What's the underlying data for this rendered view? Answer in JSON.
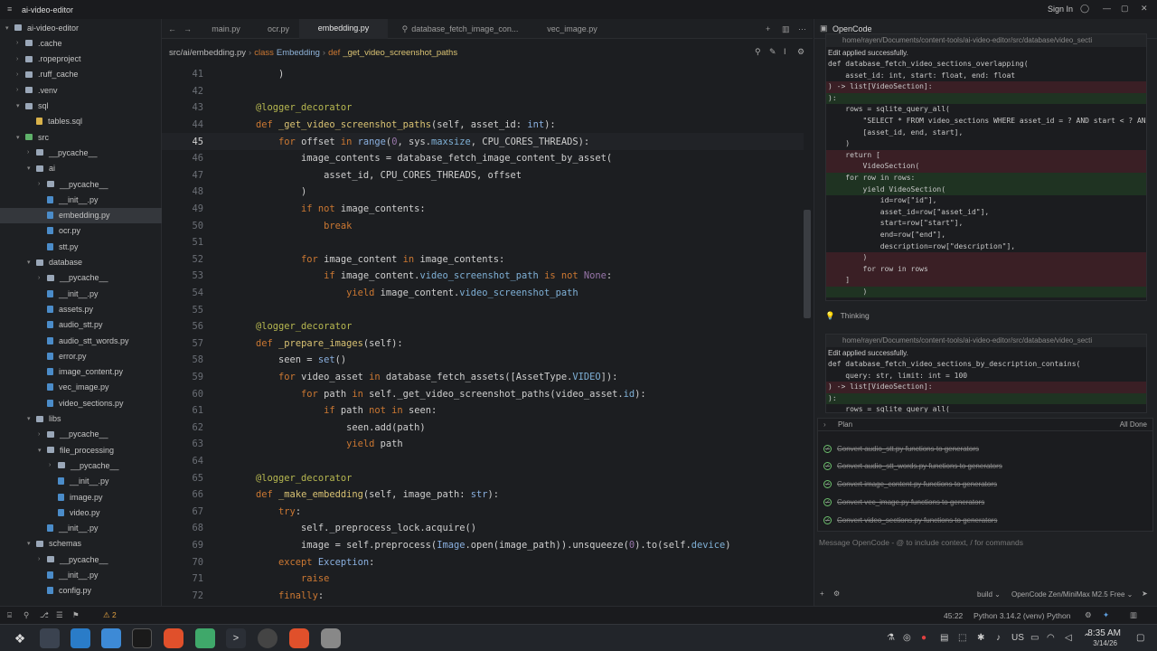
{
  "window": {
    "title": "ai-video-editor",
    "sign_in": "Sign In"
  },
  "sidebar": {
    "items": [
      {
        "label": "ai-video-editor",
        "icon": "folder-icon",
        "depth": 0,
        "open": true
      },
      {
        "label": ".cache",
        "icon": "folder-icon",
        "depth": 1
      },
      {
        "label": ".ropeproject",
        "icon": "folder-icon",
        "depth": 1
      },
      {
        "label": ".ruff_cache",
        "icon": "folder-icon",
        "depth": 1
      },
      {
        "label": ".venv",
        "icon": "folder-icon",
        "depth": 1
      },
      {
        "label": "sql",
        "icon": "folder-icon",
        "depth": 1,
        "open": true
      },
      {
        "label": "tables.sql",
        "icon": "sql-file-icon",
        "depth": 2
      },
      {
        "label": "src",
        "icon": "folder-icon",
        "depth": 1,
        "open": true
      },
      {
        "label": "__pycache__",
        "icon": "folder-icon",
        "depth": 2
      },
      {
        "label": "ai",
        "icon": "folder-icon",
        "depth": 2,
        "open": true
      },
      {
        "label": "__pycache__",
        "icon": "folder-icon",
        "depth": 3
      },
      {
        "label": "__init__.py",
        "icon": "python-file-icon",
        "depth": 3
      },
      {
        "label": "embedding.py",
        "icon": "python-file-icon",
        "depth": 3,
        "selected": true
      },
      {
        "label": "ocr.py",
        "icon": "python-file-icon",
        "depth": 3
      },
      {
        "label": "stt.py",
        "icon": "python-file-icon",
        "depth": 3
      },
      {
        "label": "database",
        "icon": "folder-icon",
        "depth": 2,
        "open": true
      },
      {
        "label": "__pycache__",
        "icon": "folder-icon",
        "depth": 3
      },
      {
        "label": "__init__.py",
        "icon": "python-file-icon",
        "depth": 3
      },
      {
        "label": "assets.py",
        "icon": "python-file-icon",
        "depth": 3
      },
      {
        "label": "audio_stt.py",
        "icon": "python-file-icon",
        "depth": 3
      },
      {
        "label": "audio_stt_words.py",
        "icon": "python-file-icon",
        "depth": 3
      },
      {
        "label": "error.py",
        "icon": "python-file-icon",
        "depth": 3
      },
      {
        "label": "image_content.py",
        "icon": "python-file-icon",
        "depth": 3
      },
      {
        "label": "vec_image.py",
        "icon": "python-file-icon",
        "depth": 3
      },
      {
        "label": "video_sections.py",
        "icon": "python-file-icon",
        "depth": 3
      },
      {
        "label": "libs",
        "icon": "folder-icon",
        "depth": 2,
        "open": true
      },
      {
        "label": "__pycache__",
        "icon": "folder-icon",
        "depth": 3
      },
      {
        "label": "file_processing",
        "icon": "folder-icon",
        "depth": 3,
        "open": true
      },
      {
        "label": "__pycache__",
        "icon": "folder-icon",
        "depth": 4
      },
      {
        "label": "__init__.py",
        "icon": "python-file-icon",
        "depth": 4
      },
      {
        "label": "image.py",
        "icon": "python-file-icon",
        "depth": 4
      },
      {
        "label": "video.py",
        "icon": "python-file-icon",
        "depth": 4
      },
      {
        "label": "__init__.py",
        "icon": "python-file-icon",
        "depth": 3
      },
      {
        "label": "schemas",
        "icon": "folder-icon",
        "depth": 2,
        "open": true
      },
      {
        "label": "__pycache__",
        "icon": "folder-icon",
        "depth": 3
      },
      {
        "label": "__init__.py",
        "icon": "python-file-icon",
        "depth": 3
      },
      {
        "label": "config.py",
        "icon": "python-file-icon",
        "depth": 3
      }
    ]
  },
  "tabs": [
    {
      "label": "main.py",
      "active": false
    },
    {
      "label": "ocr.py",
      "active": false
    },
    {
      "label": "embedding.py",
      "active": true
    },
    {
      "label": "database_fetch_image_con...",
      "active": false
    },
    {
      "label": "vec_image.py",
      "active": false
    }
  ],
  "breadcrumb": {
    "path": "src/ai/embedding.py",
    "sep": "›",
    "kw_class": "class",
    "class_name": "Embedding",
    "kw_def": "def",
    "function": "_get_video_screenshot_paths"
  },
  "editor": {
    "current_line": 45,
    "lines": [
      {
        "n": "41",
        "html": "    )"
      },
      {
        "n": "42",
        "html": ""
      },
      {
        "n": "43",
        "html": "<span class='d'>@logger_decorator</span>"
      },
      {
        "n": "44",
        "html": "<span class='k'>def</span> <span class='f'>_get_video_screenshot_paths</span>(self, asset_id: <span class='b'>int</span>):"
      },
      {
        "n": "45",
        "html": "    <span class='k'>for</span> offset <span class='k'>in</span> <span class='b'>range</span>(<span class='c'>0</span>, sys.<span class='n'>maxsize</span>, CPU_CORES_THREADS):"
      },
      {
        "n": "46",
        "html": "        image_contents = database_fetch_image_content_by_asset("
      },
      {
        "n": "47",
        "html": "            asset_id, CPU_CORES_THREADS, offset"
      },
      {
        "n": "48",
        "html": "        )"
      },
      {
        "n": "49",
        "html": "        <span class='k'>if not</span> image_contents:"
      },
      {
        "n": "50",
        "html": "            <span class='k'>break</span>"
      },
      {
        "n": "51",
        "html": ""
      },
      {
        "n": "52",
        "html": "        <span class='k'>for</span> image_content <span class='k'>in</span> image_contents:"
      },
      {
        "n": "53",
        "html": "            <span class='k'>if</span> image_content.<span class='n'>video_screenshot_path</span> <span class='k'>is not</span> <span class='c'>None</span>:"
      },
      {
        "n": "54",
        "html": "                <span class='k'>yield</span> image_content.<span class='n'>video_screenshot_path</span>"
      },
      {
        "n": "55",
        "html": ""
      },
      {
        "n": "56",
        "html": "<span class='d'>@logger_decorator</span>"
      },
      {
        "n": "57",
        "html": "<span class='k'>def</span> <span class='f'>_prepare_images</span>(self):"
      },
      {
        "n": "58",
        "html": "    seen = <span class='b'>set</span>()"
      },
      {
        "n": "59",
        "html": "    <span class='k'>for</span> video_asset <span class='k'>in</span> database_fetch_assets([AssetType.<span class='n'>VIDEO</span>]):"
      },
      {
        "n": "60",
        "html": "        <span class='k'>for</span> path <span class='k'>in</span> self._get_video_screenshot_paths(video_asset.<span class='n'>id</span>):"
      },
      {
        "n": "61",
        "html": "            <span class='k'>if</span> path <span class='k'>not in</span> seen:"
      },
      {
        "n": "62",
        "html": "                seen.add(path)"
      },
      {
        "n": "63",
        "html": "                <span class='k'>yield</span> path"
      },
      {
        "n": "64",
        "html": ""
      },
      {
        "n": "65",
        "html": "<span class='d'>@logger_decorator</span>"
      },
      {
        "n": "66",
        "html": "<span class='k'>def</span> <span class='f'>_make_embedding</span>(self, image_path: <span class='b'>str</span>):"
      },
      {
        "n": "67",
        "html": "    <span class='k'>try</span>:"
      },
      {
        "n": "68",
        "html": "        self._preprocess_lock.acquire()"
      },
      {
        "n": "69",
        "html": "        image = self.preprocess(<span class='b'>Image</span>.open(image_path)).unsqueeze(<span class='c'>0</span>).to(self.<span class='n'>device</span>)"
      },
      {
        "n": "70",
        "html": "    <span class='k'>except</span> <span class='b'>Exception</span>:"
      },
      {
        "n": "71",
        "html": "        <span class='k'>raise</span>"
      },
      {
        "n": "72",
        "html": "    <span class='k'>finally</span>:"
      }
    ]
  },
  "panel": {
    "title": "OpenCode",
    "diff1": {
      "path": "home/rayen/Documents/content-tools/ai-video-editor/src/database/video_secti",
      "note": "Edit applied successfully.",
      "lines": [
        {
          "t": "ctx",
          "text": "def database_fetch_video_sections_overlapping("
        },
        {
          "t": "ctx",
          "text": "    asset_id: int, start: float, end: float"
        },
        {
          "t": "del",
          "text": ") -> list[VideoSection]:"
        },
        {
          "t": "add",
          "text": "):"
        },
        {
          "t": "ctx",
          "text": "    rows = sqlite_query_all("
        },
        {
          "t": "ctx",
          "text": "        \"SELECT * FROM video_sections WHERE asset_id = ? AND start < ? AND"
        },
        {
          "t": "ctx",
          "text": "        [asset_id, end, start],"
        },
        {
          "t": "ctx",
          "text": "    )"
        },
        {
          "t": "del",
          "text": "    return ["
        },
        {
          "t": "del",
          "text": "        VideoSection("
        },
        {
          "t": "add",
          "text": "    for row in rows:"
        },
        {
          "t": "add",
          "text": "        yield VideoSection("
        },
        {
          "t": "ctx",
          "text": "            id=row[\"id\"],"
        },
        {
          "t": "ctx",
          "text": "            asset_id=row[\"asset_id\"],"
        },
        {
          "t": "ctx",
          "text": "            start=row[\"start\"],"
        },
        {
          "t": "ctx",
          "text": "            end=row[\"end\"],"
        },
        {
          "t": "ctx",
          "text": "            description=row[\"description\"],"
        },
        {
          "t": "del",
          "text": "        )"
        },
        {
          "t": "del",
          "text": "        for row in rows"
        },
        {
          "t": "del",
          "text": "    ]"
        },
        {
          "t": "add",
          "text": "        )"
        }
      ]
    },
    "thinking": "Thinking",
    "diff2": {
      "path": "home/rayen/Documents/content-tools/ai-video-editor/src/database/video_secti",
      "note": "Edit applied successfully.",
      "lines": [
        {
          "t": "ctx",
          "text": "def database_fetch_video_sections_by_description_contains("
        },
        {
          "t": "ctx",
          "text": "    query: str, limit: int = 100"
        },
        {
          "t": "del",
          "text": ") -> list[VideoSection]:"
        },
        {
          "t": "add",
          "text": "):"
        },
        {
          "t": "ctx",
          "text": "    rows = sqlite_query_all("
        }
      ]
    },
    "plan": {
      "title": "Plan",
      "status": "All Done",
      "items": [
        "Convert audio_stt.py functions to generators",
        "Convert audio_stt_words.py functions to generators",
        "Convert image_content.py functions to generators",
        "Convert vec_image.py functions to generators",
        "Convert video_sections.py functions to generators"
      ]
    },
    "message_placeholder": "Message OpenCode - @ to include context, / for commands",
    "footer": {
      "mode": "build",
      "model": "OpenCode Zen/MiniMax M2.5 Free"
    }
  },
  "status": {
    "warnings": "2",
    "position": "45:22",
    "python_version": "Python 3.14.2 (venv)",
    "language": "Python"
  },
  "taskbar": {
    "keyboard": "US",
    "time": "8:35 AM",
    "date": "3/14/26"
  }
}
